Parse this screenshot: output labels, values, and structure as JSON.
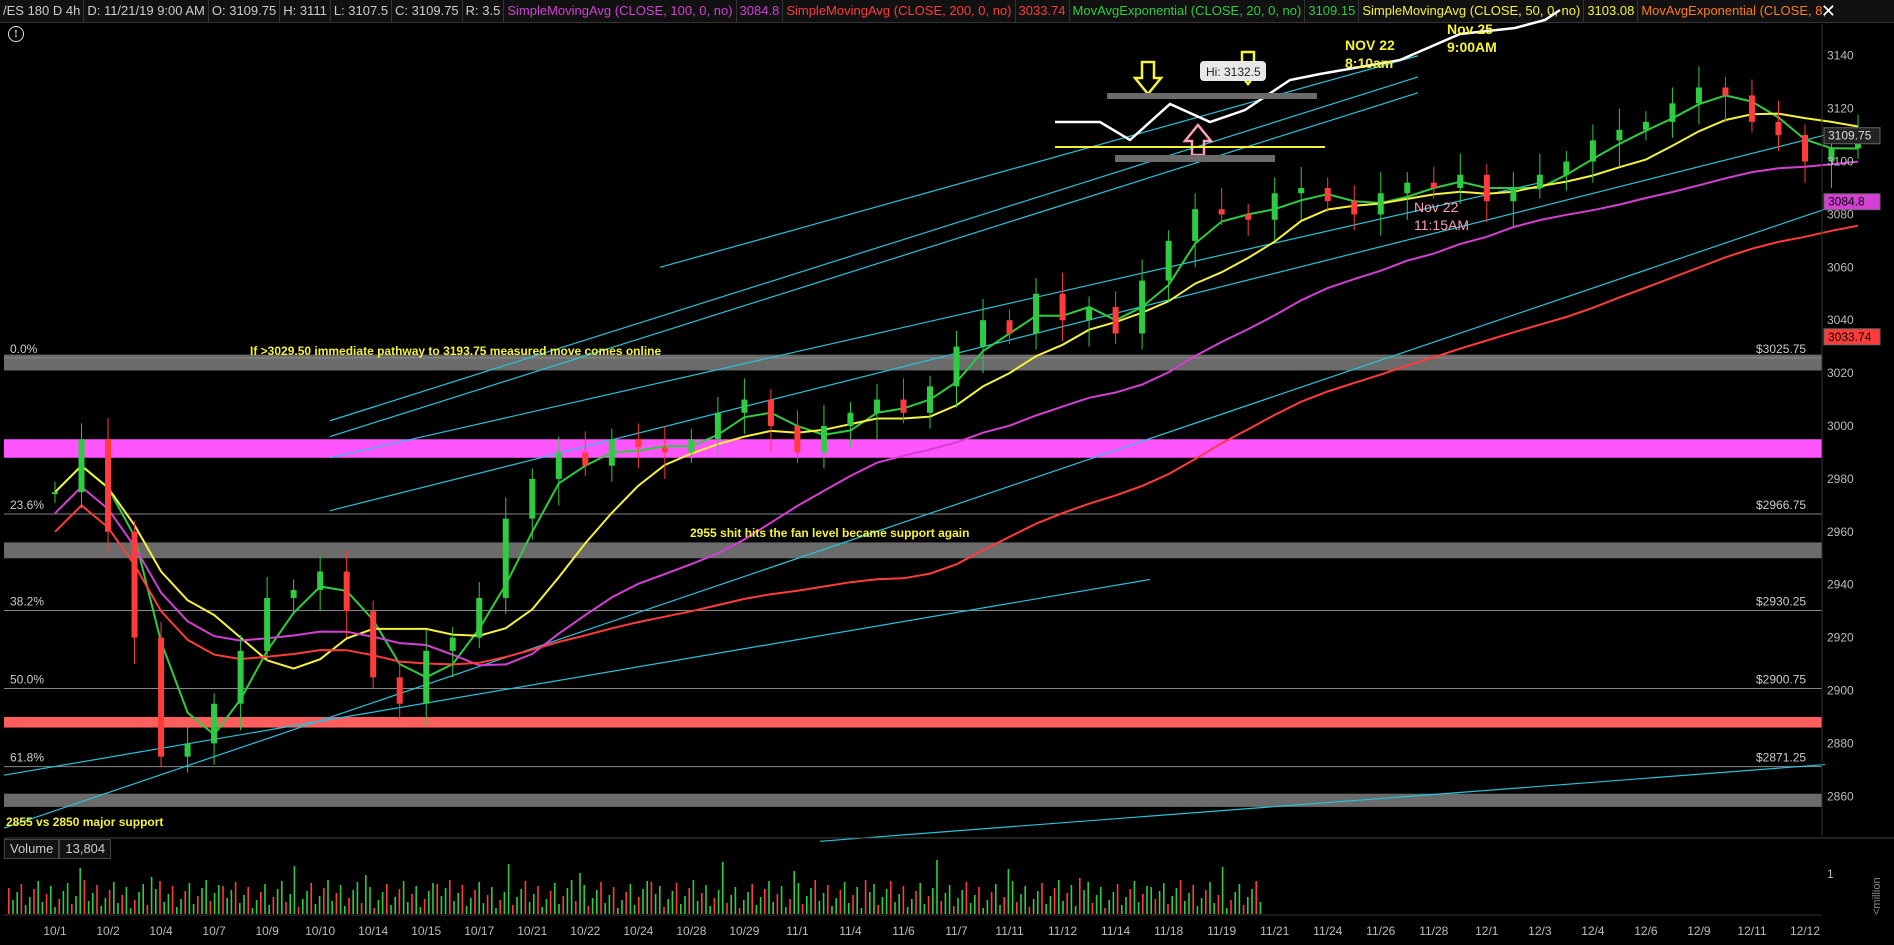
{
  "header": {
    "symbol": "/ES 180 D 4h",
    "date": "D: 11/21/19 9:00 AM",
    "open": "O: 3109.75",
    "high": "H: 3111",
    "low": "L: 3107.5",
    "close": "C: 3109.75",
    "range": "R: 3.5",
    "studies": [
      {
        "label": "SimpleMovingAvg (CLOSE, 100, 0, no)",
        "value": "3084.8",
        "color": "#d43fd4"
      },
      {
        "label": "SimpleMovingAvg (CLOSE, 200, 0, no)",
        "value": "3033.74",
        "color": "#ff3b3b"
      },
      {
        "label": "MovAvgExponential (CLOSE, 20, 0, no)",
        "value": "3109.15",
        "color": "#2ecc40"
      },
      {
        "label": "SimpleMovingAvg (CLOSE, 50, 0, no)",
        "value": "3103.08",
        "color": "#f5f23a"
      },
      {
        "label": "MovAvgExponential (CLOSE, 8,",
        "value": "",
        "color": "#ff7a1a"
      }
    ]
  },
  "icons": {
    "info": "info-icon",
    "close": "close-icon"
  },
  "chart_data": {
    "type": "candlestick",
    "ylim": [
      2845,
      3152
    ],
    "y_ticks": [
      2860,
      2880,
      2900,
      2920,
      2940,
      2960,
      2980,
      3000,
      3020,
      3040,
      3060,
      3080,
      3100,
      3120,
      3140
    ],
    "x_ticks": [
      "10/1",
      "10/2",
      "10/4",
      "10/7",
      "10/9",
      "10/10",
      "10/14",
      "10/15",
      "10/17",
      "10/21",
      "10/22",
      "10/24",
      "10/28",
      "10/29",
      "11/1",
      "11/4",
      "11/6",
      "11/7",
      "11/11",
      "11/12",
      "11/14",
      "11/18",
      "11/19",
      "11/21",
      "11/24",
      "11/26",
      "11/28",
      "12/1",
      "12/3",
      "12/4",
      "12/6",
      "12/9",
      "12/11",
      "12/12"
    ],
    "price_tags": [
      {
        "value": 3109.75,
        "label": "3109.75",
        "bg": "#222",
        "fg": "#ddd"
      },
      {
        "value": 3084.8,
        "label": "3084.8",
        "bg": "#d43fd4",
        "fg": "#000"
      },
      {
        "value": 3033.74,
        "label": "3033.74",
        "bg": "#ff3b3b",
        "fg": "#000"
      }
    ],
    "fib_levels": [
      {
        "pct": "0.0%",
        "price": 3025.75,
        "label": "$3025.75"
      },
      {
        "pct": "23.6%",
        "price": 2966.75,
        "label": "$2966.75"
      },
      {
        "pct": "38.2%",
        "price": 2930.25,
        "label": "$2930.25"
      },
      {
        "pct": "50.0%",
        "price": 2900.75,
        "label": "$2900.75"
      },
      {
        "pct": "61.8%",
        "price": 2871.25,
        "label": "$2871.25"
      }
    ],
    "zones": [
      {
        "from": 3021,
        "to": 3027,
        "color": "#6b6b6b"
      },
      {
        "from": 2988,
        "to": 2995,
        "color": "#ff55ff"
      },
      {
        "from": 2950,
        "to": 2956,
        "color": "#6b6b6b"
      },
      {
        "from": 2886,
        "to": 2890,
        "color": "#ff5e5e"
      },
      {
        "from": 2856,
        "to": 2861,
        "color": "#6b6b6b"
      }
    ],
    "annotations": [
      {
        "text": "If >3029.50 immediate pathway to 3193.75 measured move comes online",
        "color": "#f5f23a"
      },
      {
        "text": "2955 shit hits the fan level became support again",
        "color": "#f5f23a"
      },
      {
        "text": "2855 vs 2850 major support",
        "color": "#f5f23a"
      },
      {
        "text": "NOV 22",
        "color": "#f5f23a"
      },
      {
        "text": "8:10am",
        "color": "#f5f23a"
      },
      {
        "text": "Nov 25",
        "color": "#f5f23a"
      },
      {
        "text": "9:00AM",
        "color": "#f5f23a"
      },
      {
        "text": "Nov 22",
        "color": "#ff9fb5"
      },
      {
        "text": "11:15AM",
        "color": "#ff9fb5"
      },
      {
        "text": "Hi: 3132.5",
        "color": "#222"
      }
    ],
    "volume": {
      "label": "Volume",
      "value": "13,804",
      "axis_label": "1",
      "unit_label": "<million"
    },
    "close_path": [
      [
        0,
        2975
      ],
      [
        0.5,
        2995
      ],
      [
        1,
        2960
      ],
      [
        1.5,
        2920
      ],
      [
        2,
        2875
      ],
      [
        2.5,
        2880
      ],
      [
        3,
        2895
      ],
      [
        3.5,
        2915
      ],
      [
        4,
        2935
      ],
      [
        4.5,
        2938
      ],
      [
        5,
        2945
      ],
      [
        5.5,
        2930
      ],
      [
        6,
        2905
      ],
      [
        6.5,
        2895
      ],
      [
        7,
        2915
      ],
      [
        7.5,
        2920
      ],
      [
        8,
        2935
      ],
      [
        8.5,
        2965
      ],
      [
        9,
        2980
      ],
      [
        9.5,
        2990
      ],
      [
        10,
        2985
      ],
      [
        10.5,
        2995
      ],
      [
        11,
        2992
      ],
      [
        11.5,
        2990
      ],
      [
        12,
        2995
      ],
      [
        12.5,
        3005
      ],
      [
        13,
        3010
      ],
      [
        13.5,
        3000
      ],
      [
        14,
        2990
      ],
      [
        14.5,
        3000
      ],
      [
        15,
        3005
      ],
      [
        15.5,
        3010
      ],
      [
        16,
        3005
      ],
      [
        16.5,
        3015
      ],
      [
        17,
        3030
      ],
      [
        17.5,
        3040
      ],
      [
        18,
        3035
      ],
      [
        18.5,
        3050
      ],
      [
        19,
        3040
      ],
      [
        19.5,
        3045
      ],
      [
        20,
        3035
      ],
      [
        20.5,
        3055
      ],
      [
        21,
        3070
      ],
      [
        21.5,
        3082
      ],
      [
        22,
        3080
      ],
      [
        22.5,
        3078
      ],
      [
        23,
        3088
      ],
      [
        23.5,
        3090
      ],
      [
        24,
        3085
      ],
      [
        24.5,
        3080
      ],
      [
        25,
        3088
      ],
      [
        25.5,
        3092
      ],
      [
        26,
        3090
      ],
      [
        26.5,
        3095
      ],
      [
        27,
        3085
      ],
      [
        27.5,
        3090
      ],
      [
        28,
        3095
      ],
      [
        28.5,
        3100
      ],
      [
        29,
        3108
      ],
      [
        29.5,
        3112
      ],
      [
        30,
        3115
      ],
      [
        30.5,
        3122
      ],
      [
        31,
        3128
      ],
      [
        31.5,
        3125
      ],
      [
        32,
        3115
      ],
      [
        32.5,
        3110
      ],
      [
        33,
        3100
      ],
      [
        33.5,
        3105
      ],
      [
        34,
        3109.75
      ]
    ]
  }
}
